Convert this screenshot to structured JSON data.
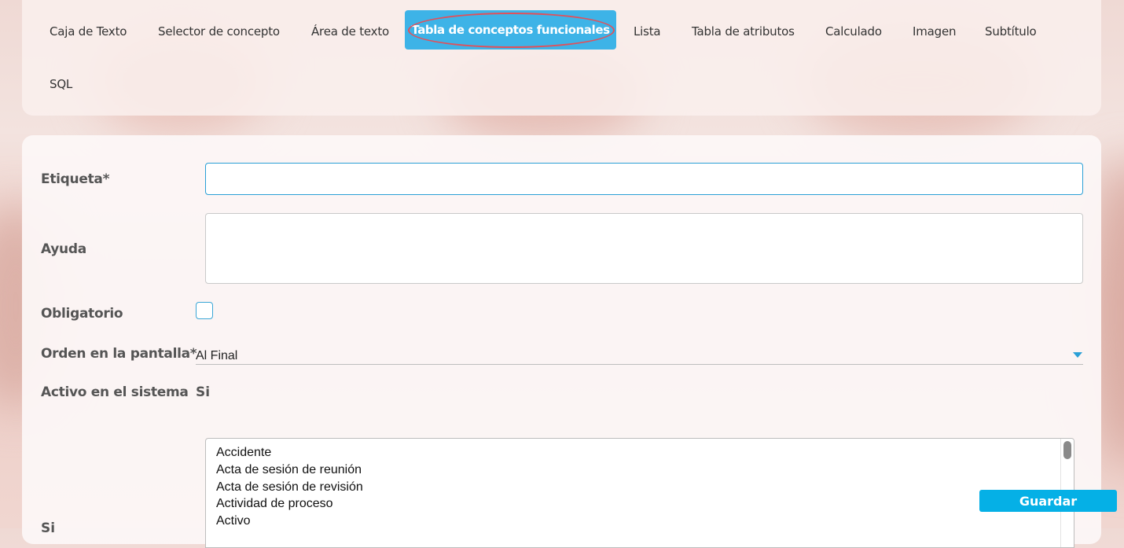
{
  "tabs": [
    {
      "label": "Caja de Texto"
    },
    {
      "label": "Selector de concepto"
    },
    {
      "label": "Área de texto"
    },
    {
      "label": "Tabla de conceptos funcionales"
    },
    {
      "label": "Lista"
    },
    {
      "label": "Tabla de atributos"
    },
    {
      "label": "Calculado"
    },
    {
      "label": "Imagen"
    },
    {
      "label": "Subtítulo"
    },
    {
      "label": "SQL"
    }
  ],
  "active_tab": "Tabla de conceptos funcionales",
  "form": {
    "etiqueta_label": "Etiqueta*",
    "etiqueta_value": "",
    "ayuda_label": "Ayuda",
    "ayuda_value": "",
    "obligatorio_label": "Obligatorio",
    "orden_label": "Orden en la pantalla*",
    "orden_value": "Al Final",
    "activo_label": "Activo en el sistema",
    "activo_value": "Si",
    "concepts_label": "Si",
    "concepts": [
      "Accidente",
      "Acta de sesión de reunión",
      "Acta de sesión de revisión",
      "Actividad de proceso",
      "Activo"
    ]
  },
  "actions": {
    "save_label": "Guardar"
  },
  "colors": {
    "accent": "#3db3e7",
    "highlight_ring": "#e2505a",
    "save_button": "#05b0e6"
  }
}
